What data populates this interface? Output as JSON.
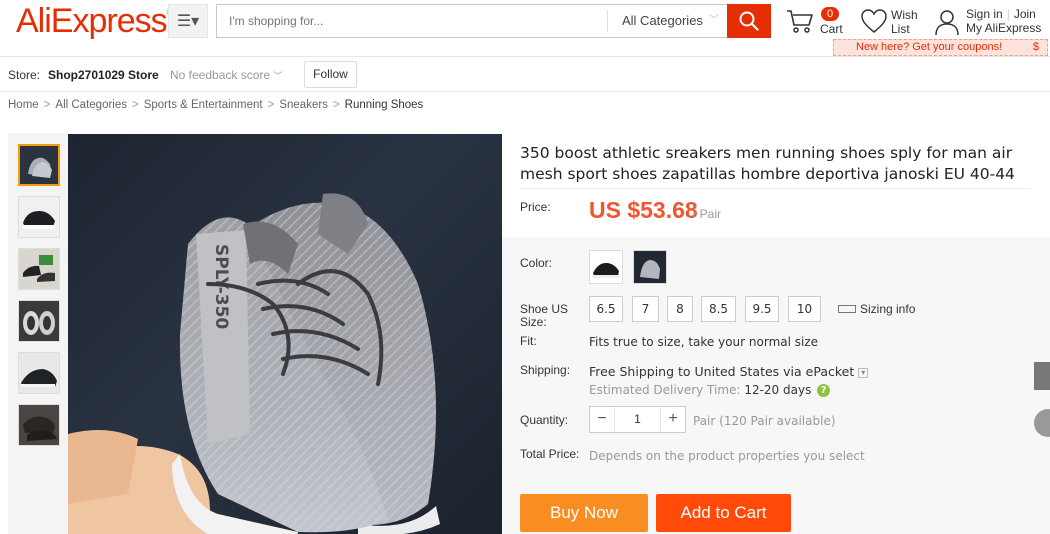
{
  "header": {
    "logo": "AliExpress",
    "search_placeholder": "I'm shopping for...",
    "category": "All Categories",
    "cart_count": "0",
    "cart_label": "Cart",
    "wish_line1": "Wish",
    "wish_line2": "List",
    "signin": "Sign in",
    "join": "Join",
    "my_account": "My AliExpress",
    "coupon": "New here? Get your coupons!",
    "coupon_symbol": "$"
  },
  "store": {
    "label": "Store:",
    "name": "Shop2701029 Store",
    "feedback": "No feedback score",
    "follow": "Follow"
  },
  "breadcrumb": [
    "Home",
    "All Categories",
    "Sports & Entertainment",
    "Sneakers",
    "Running Shoes"
  ],
  "product": {
    "title": "350 boost athletic sreakers men running shoes sply for man air mesh sport shoes zapatillas hombre deportiva janoski EU 40-44",
    "price_label": "Price:",
    "price": "US $53.68",
    "unit": "/ Pair",
    "color_label": "Color:",
    "size_label": "Shoe US Size:",
    "sizes": [
      "6.5",
      "7",
      "8",
      "8.5",
      "9.5",
      "10"
    ],
    "sizing_info": "Sizing info",
    "fit_label": "Fit:",
    "fit": "Fits true to size, take your normal size",
    "shipping_label": "Shipping:",
    "shipping_free": "Free Shipping",
    "shipping_to": " to United States via ePacket",
    "delivery_label": "Estimated Delivery Time:",
    "delivery_time": "12-20 days",
    "quantity_label": "Quantity:",
    "quantity": "1",
    "available": "Pair (120 Pair available)",
    "total_label": "Total Price:",
    "total": "Depends on the product properties you select",
    "buy_now": "Buy Now",
    "add_to_cart": "Add to Cart",
    "shoe_text": "SPLY-350"
  },
  "colors": {
    "brand": "#e62e04",
    "price": "#f25430",
    "buy_now": "#fa8d22",
    "add_to_cart": "#ff4a09"
  }
}
